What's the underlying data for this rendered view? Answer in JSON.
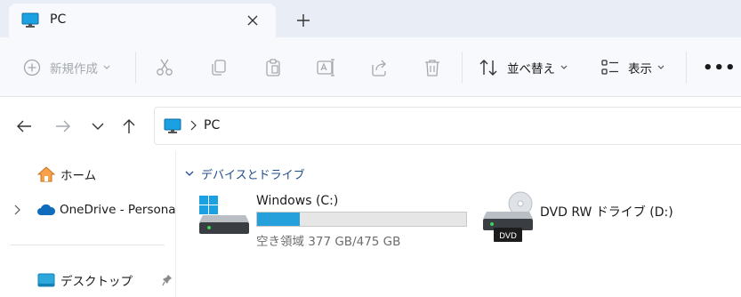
{
  "tab": {
    "title": "PC",
    "icon": "monitor-icon"
  },
  "toolbar": {
    "new_label": "新規作成",
    "sort_label": "並べ替え",
    "view_label": "表示",
    "more": "•••"
  },
  "address": {
    "path": "PC"
  },
  "sidebar": {
    "items": [
      {
        "label": "ホーム",
        "icon": "home-icon"
      },
      {
        "label": "OneDrive - Persona",
        "icon": "cloud-icon"
      },
      {
        "label": "デスクトップ",
        "icon": "desktop-folder-icon"
      }
    ]
  },
  "content": {
    "group_title": "デバイスとドライブ",
    "drives": [
      {
        "name": "Windows (C:)",
        "free_text": "空き領域 377 GB/475 GB",
        "used_fraction": 0.206
      },
      {
        "name": "DVD RW ドライブ (D:)",
        "badge": "DVD"
      }
    ]
  },
  "colors": {
    "accent": "#26a0da",
    "chrome": "#e9eef6",
    "toolbar": "#f7f9fc",
    "group_title": "#1f4e8c"
  }
}
